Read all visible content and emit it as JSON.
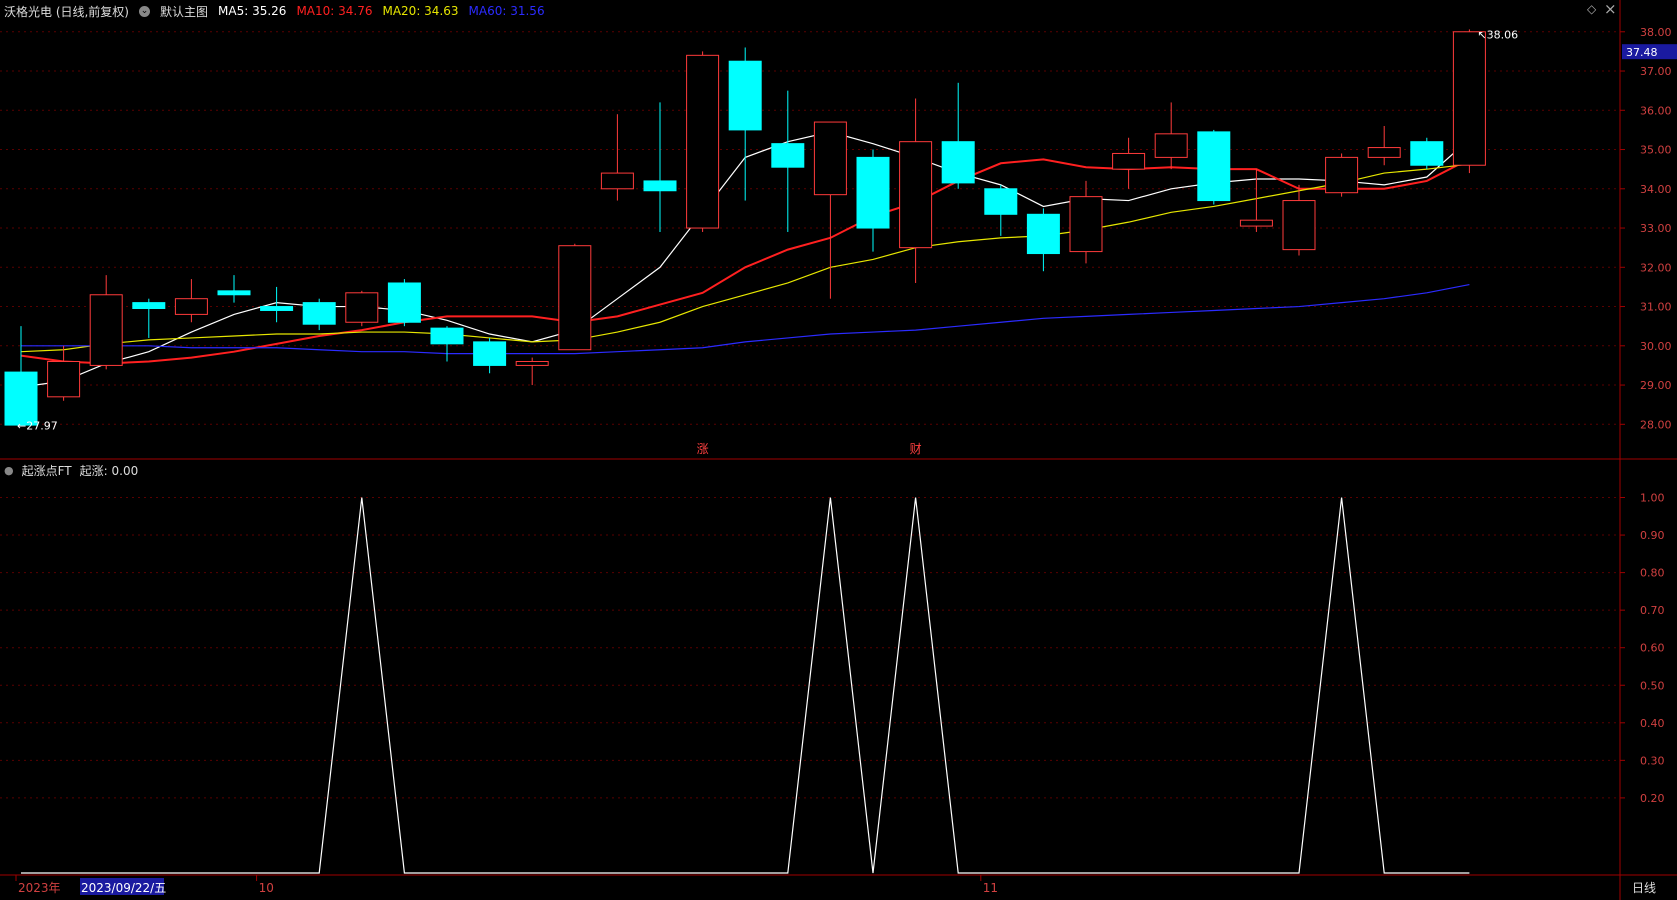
{
  "header": {
    "title": "沃格光电 (日线,前复权)",
    "main_label": "默认主图",
    "ma5": "MA5: 35.26",
    "ma10": "MA10: 34.76",
    "ma20": "MA20: 34.63",
    "ma60": "MA60: 31.56",
    "diamond": "◇",
    "close": "×"
  },
  "colors": {
    "up": "#ff3b3b",
    "down": "#00ffff",
    "ma5": "#ffffff",
    "ma10": "#ff2020",
    "ma20": "#e6e600",
    "ma60": "#2b2bff",
    "axis": "#a00000",
    "indicator": "#ffffff"
  },
  "chart_data": [
    {
      "type": "candlestick",
      "title": "沃格光电 (日线,前复权)",
      "ylim": [
        27.6,
        38.3
      ],
      "yticks": [
        "38.00",
        "37.00",
        "36.00",
        "35.00",
        "34.00",
        "33.00",
        "32.00",
        "31.00",
        "30.00",
        "29.00",
        "28.00"
      ],
      "current_price_label": "37.48",
      "high_annotation": "38.06",
      "low_annotation": "27.97",
      "candles": [
        {
          "o": 29.33,
          "c": 27.98,
          "h": 30.5,
          "l": 27.97
        },
        {
          "o": 28.7,
          "c": 29.6,
          "h": 30.0,
          "l": 28.6
        },
        {
          "o": 29.5,
          "c": 31.3,
          "h": 31.8,
          "l": 29.4
        },
        {
          "o": 31.1,
          "c": 30.95,
          "h": 31.2,
          "l": 30.2
        },
        {
          "o": 30.8,
          "c": 31.2,
          "h": 31.7,
          "l": 30.6
        },
        {
          "o": 31.4,
          "c": 31.3,
          "h": 31.8,
          "l": 31.1
        },
        {
          "o": 31.0,
          "c": 30.9,
          "h": 31.5,
          "l": 30.6
        },
        {
          "o": 31.1,
          "c": 30.55,
          "h": 31.2,
          "l": 30.4
        },
        {
          "o": 30.6,
          "c": 31.35,
          "h": 31.4,
          "l": 30.5
        },
        {
          "o": 31.6,
          "c": 30.6,
          "h": 31.7,
          "l": 30.5
        },
        {
          "o": 30.45,
          "c": 30.05,
          "h": 30.5,
          "l": 29.6
        },
        {
          "o": 30.1,
          "c": 29.5,
          "h": 30.2,
          "l": 29.3
        },
        {
          "o": 29.5,
          "c": 29.6,
          "h": 29.7,
          "l": 29.0
        },
        {
          "o": 29.9,
          "c": 32.55,
          "h": 32.6,
          "l": 29.9
        },
        {
          "o": 34.0,
          "c": 34.4,
          "h": 35.9,
          "l": 33.7
        },
        {
          "o": 34.2,
          "c": 33.95,
          "h": 36.2,
          "l": 32.9
        },
        {
          "o": 33.0,
          "c": 37.4,
          "h": 37.5,
          "l": 32.9
        },
        {
          "o": 37.25,
          "c": 35.5,
          "h": 37.6,
          "l": 33.7
        },
        {
          "o": 35.15,
          "c": 34.55,
          "h": 36.5,
          "l": 32.9
        },
        {
          "o": 33.85,
          "c": 35.7,
          "h": 35.7,
          "l": 31.2
        },
        {
          "o": 34.8,
          "c": 33.0,
          "h": 35.0,
          "l": 32.4
        },
        {
          "o": 32.5,
          "c": 35.2,
          "h": 36.3,
          "l": 31.6
        },
        {
          "o": 35.2,
          "c": 34.15,
          "h": 36.7,
          "l": 34.0
        },
        {
          "o": 34.0,
          "c": 33.35,
          "h": 34.1,
          "l": 32.8
        },
        {
          "o": 33.35,
          "c": 32.35,
          "h": 33.5,
          "l": 31.9
        },
        {
          "o": 32.4,
          "c": 33.8,
          "h": 34.2,
          "l": 32.1
        },
        {
          "o": 34.5,
          "c": 34.9,
          "h": 35.3,
          "l": 34.0
        },
        {
          "o": 34.8,
          "c": 35.4,
          "h": 36.2,
          "l": 34.5
        },
        {
          "o": 35.45,
          "c": 33.7,
          "h": 35.5,
          "l": 33.6
        },
        {
          "o": 33.05,
          "c": 33.2,
          "h": 34.5,
          "l": 32.9
        },
        {
          "o": 32.45,
          "c": 33.7,
          "h": 34.1,
          "l": 32.3
        },
        {
          "o": 33.9,
          "c": 34.8,
          "h": 34.9,
          "l": 33.8
        },
        {
          "o": 34.8,
          "c": 35.05,
          "h": 35.6,
          "l": 34.6
        },
        {
          "o": 35.2,
          "c": 34.6,
          "h": 35.3,
          "l": 34.5
        },
        {
          "o": 34.6,
          "c": 38.0,
          "h": 38.06,
          "l": 34.4
        }
      ],
      "series": [
        {
          "name": "MA5",
          "values": [
            28.95,
            29.1,
            29.55,
            29.85,
            30.35,
            30.8,
            31.1,
            31.0,
            31.0,
            30.9,
            30.65,
            30.3,
            30.1,
            30.4,
            31.2,
            32.0,
            33.4,
            34.8,
            35.2,
            35.45,
            35.15,
            34.8,
            34.4,
            34.1,
            33.55,
            33.75,
            33.7,
            34.0,
            34.15,
            34.25,
            34.25,
            34.2,
            34.1,
            34.3,
            35.26
          ]
        },
        {
          "name": "MA10",
          "values": [
            29.75,
            29.6,
            29.55,
            29.6,
            29.7,
            29.85,
            30.05,
            30.25,
            30.4,
            30.6,
            30.75,
            30.75,
            30.75,
            30.6,
            30.75,
            31.05,
            31.35,
            32.0,
            32.45,
            32.75,
            33.3,
            33.65,
            34.2,
            34.65,
            34.75,
            34.55,
            34.5,
            34.55,
            34.5,
            34.5,
            34.0,
            34.0,
            34.0,
            34.2,
            34.76
          ]
        },
        {
          "name": "MA20",
          "values": [
            29.85,
            29.9,
            30.05,
            30.15,
            30.2,
            30.25,
            30.3,
            30.3,
            30.35,
            30.35,
            30.3,
            30.2,
            30.1,
            30.15,
            30.35,
            30.6,
            31.0,
            31.3,
            31.6,
            32.0,
            32.2,
            32.5,
            32.65,
            32.75,
            32.8,
            32.95,
            33.15,
            33.4,
            33.55,
            33.75,
            33.95,
            34.15,
            34.4,
            34.5,
            34.63
          ]
        },
        {
          "name": "MA60",
          "values": [
            30.0,
            30.0,
            30.0,
            30.0,
            29.95,
            29.95,
            29.95,
            29.9,
            29.85,
            29.85,
            29.8,
            29.8,
            29.8,
            29.8,
            29.85,
            29.9,
            29.95,
            30.1,
            30.2,
            30.3,
            30.35,
            30.4,
            30.5,
            30.6,
            30.7,
            30.75,
            30.8,
            30.85,
            30.9,
            30.95,
            31.0,
            31.1,
            31.2,
            31.35,
            31.56
          ]
        }
      ],
      "markers": [
        {
          "label": "涨",
          "index": 16
        },
        {
          "label": "财",
          "index": 21
        }
      ]
    },
    {
      "type": "line",
      "title": "起涨点FT",
      "value_label": "起涨: 0.00",
      "ylim": [
        0,
        1.02
      ],
      "yticks": [
        "1.00",
        "0.90",
        "0.80",
        "0.70",
        "0.60",
        "0.50",
        "0.40",
        "0.30",
        "0.20"
      ],
      "series": [
        {
          "name": "起涨",
          "values": [
            0,
            0,
            0,
            0,
            0,
            0,
            0,
            0,
            1,
            0,
            0,
            0,
            0,
            0,
            0,
            0,
            0,
            0,
            0,
            1,
            0,
            1,
            0,
            0,
            0,
            0,
            0,
            0,
            0,
            0,
            0,
            1,
            0,
            0,
            0
          ]
        }
      ]
    }
  ],
  "xaxis": {
    "labels": [
      {
        "text": "2023年",
        "index": 0
      },
      {
        "text": "10",
        "index": 6
      },
      {
        "text": "11",
        "index": 23
      }
    ],
    "cursor_label": "2023/09/22/五",
    "period_label": "日线"
  }
}
